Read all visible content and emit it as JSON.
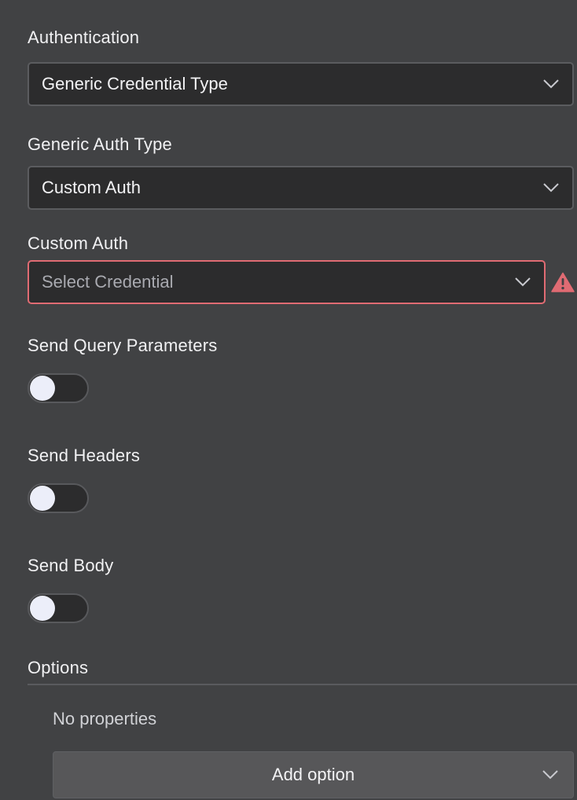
{
  "authentication": {
    "label": "Authentication",
    "value": "Generic Credential Type"
  },
  "generic_auth_type": {
    "label": "Generic Auth Type",
    "value": "Custom Auth"
  },
  "custom_auth": {
    "label": "Custom Auth",
    "placeholder": "Select Credential",
    "error_color": "#e06b73"
  },
  "send_query_parameters": {
    "label": "Send Query Parameters",
    "enabled": false
  },
  "send_headers": {
    "label": "Send Headers",
    "enabled": false
  },
  "send_body": {
    "label": "Send Body",
    "enabled": false
  },
  "options": {
    "title": "Options",
    "empty_text": "No properties",
    "add_label": "Add option"
  },
  "icons": {
    "dropdown": "chevron-down-icon",
    "warning": "warning-triangle-icon"
  }
}
